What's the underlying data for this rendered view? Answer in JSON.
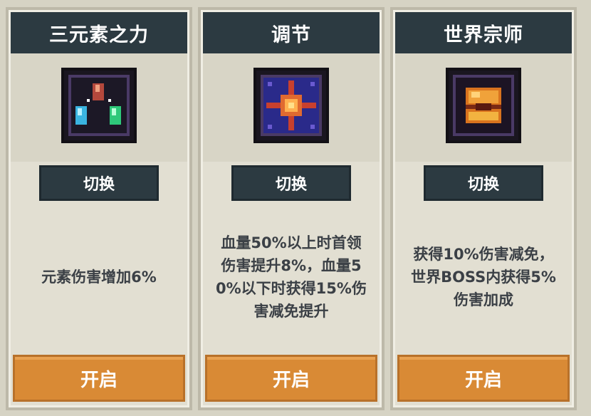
{
  "cards": [
    {
      "title": "三元素之力",
      "icon": "three-elements-gem-icon",
      "switch_label": "切换",
      "description": "元素伤害增加6%",
      "open_label": "开启"
    },
    {
      "title": "调节",
      "icon": "adjust-burst-icon",
      "switch_label": "切换",
      "description": "血量50%以上时首领\n伤害提升8%，血量5\n0%以下时获得15%伤\n害减免提升",
      "open_label": "开启"
    },
    {
      "title": "世界宗师",
      "icon": "world-master-chest-icon",
      "switch_label": "切换",
      "description": "获得10%伤害减免，\n世界BOSS内获得5%\n伤害加成",
      "open_label": "开启"
    }
  ],
  "colors": {
    "header_bg": "#2c3a41",
    "open_button": "#d98a35",
    "card_bg": "#e2dfd2"
  }
}
